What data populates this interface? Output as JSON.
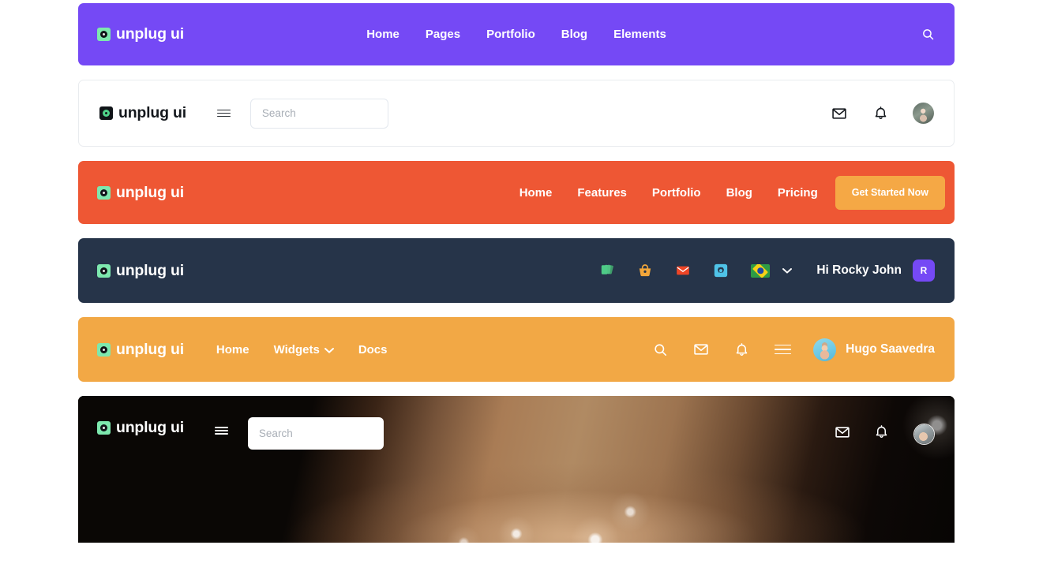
{
  "brand": {
    "name": "unplug ui"
  },
  "colors": {
    "purple": "#7549f5",
    "orange_red": "#ee5734",
    "navy": "#263449",
    "amber": "#f2a845",
    "cta_amber": "#f5a845",
    "logo_green": "#7de8ae"
  },
  "headers": [
    {
      "id": "purple-header",
      "nav": [
        {
          "label": "Home"
        },
        {
          "label": "Pages"
        },
        {
          "label": "Portfolio"
        },
        {
          "label": "Blog"
        },
        {
          "label": "Elements"
        }
      ],
      "icons": [
        "search-icon"
      ]
    },
    {
      "id": "white-header",
      "search": {
        "placeholder": "Search",
        "value": ""
      },
      "icons": [
        "hamburger-icon",
        "mail-icon",
        "bell-icon",
        "avatar"
      ]
    },
    {
      "id": "orange-header",
      "nav": [
        {
          "label": "Home"
        },
        {
          "label": "Features"
        },
        {
          "label": "Portfolio"
        },
        {
          "label": "Blog"
        },
        {
          "label": "Pricing"
        }
      ],
      "cta": {
        "label": "Get Started Now"
      }
    },
    {
      "id": "navy-header",
      "icons": [
        "cards-icon",
        "basket-icon",
        "mail-icon",
        "gear-icon"
      ],
      "language": {
        "flag": "brazil-flag",
        "caret": "chevron-down-icon"
      },
      "greeting": "Hi Rocky John",
      "avatar_initial": "R"
    },
    {
      "id": "amber-header",
      "nav": [
        {
          "label": "Home"
        },
        {
          "label": "Widgets",
          "has_caret": true
        },
        {
          "label": "Docs"
        }
      ],
      "icons": [
        "search-icon",
        "mail-icon",
        "bell-icon",
        "hamburger-icon"
      ],
      "user": {
        "name": "Hugo Saavedra"
      }
    },
    {
      "id": "photo-header",
      "search": {
        "placeholder": "Search",
        "value": ""
      },
      "icons": [
        "hamburger-icon",
        "mail-icon",
        "bell-icon",
        "avatar"
      ]
    }
  ]
}
